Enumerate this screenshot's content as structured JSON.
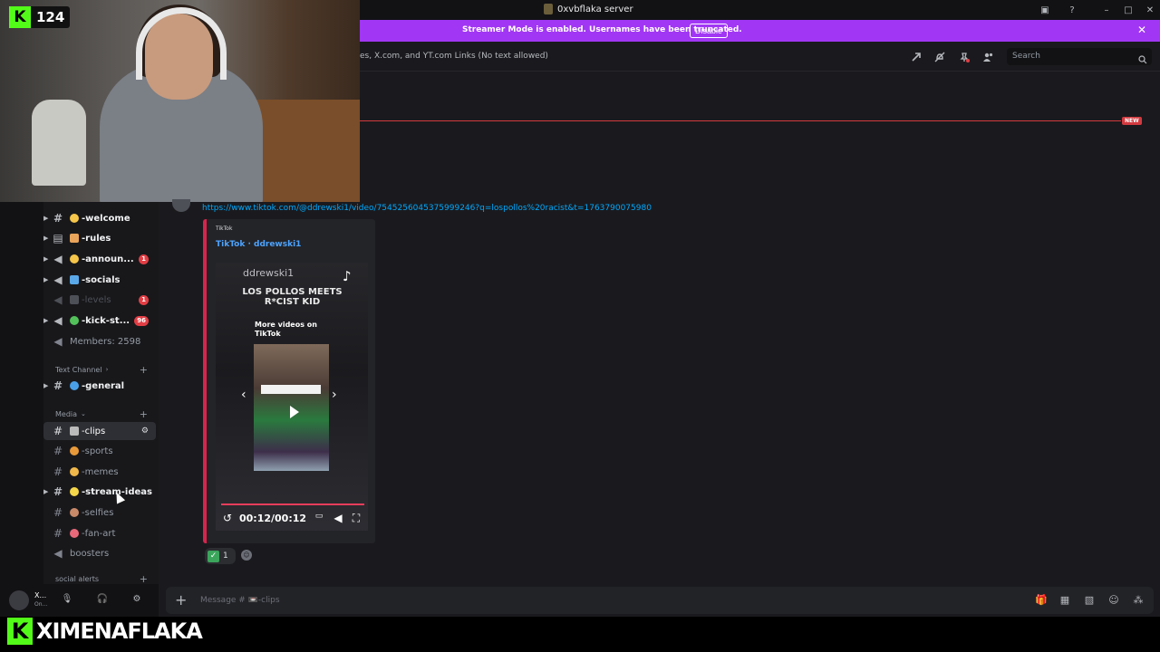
{
  "window": {
    "title": "0xvbflaka server"
  },
  "banner": {
    "text": "Streamer Mode is enabled. Usernames have been truncated.",
    "button": "Disable"
  },
  "header": {
    "topic": "es, X.com, and YT.com Links (No text allowed)",
    "search_placeholder": "Search"
  },
  "divider": {
    "new_label": "NEW"
  },
  "overlay": {
    "viewer_count": "124",
    "brand_name": "XIMENAFLAKA"
  },
  "sidebar": {
    "channels": [
      {
        "name": "-welcome",
        "badge": ""
      },
      {
        "name": "-rules",
        "badge": ""
      },
      {
        "name": "-announ...",
        "badge": "1"
      },
      {
        "name": "-socials",
        "badge": ""
      },
      {
        "name": "-levels",
        "badge": "1"
      },
      {
        "name": "-kick-st...",
        "badge": "96"
      },
      {
        "name": "Members: 2598",
        "badge": ""
      }
    ],
    "categories": {
      "text": "Text Channel",
      "media": "Media",
      "social": "social alerts"
    },
    "general": "-general",
    "media_channels": [
      "-clips",
      "-sports",
      "-memes",
      "-stream-ideas",
      "-selfies",
      "-fan-art",
      "boosters"
    ]
  },
  "user": {
    "name": "X...",
    "status": "On..."
  },
  "message": {
    "link": "https://www.tiktok.com/@ddrewski1/video/7545256045375999246?q=lospollos%20racist&t=1763790075980",
    "embed_provider": "TikTok",
    "embed_author": "TikTok · ddrewski1",
    "video_handle": "ddrewski1",
    "video_title": "LOS POLLOS MEETS R*CIST KID",
    "more_videos": "More videos on TikTok",
    "time": "00:12/00:12",
    "progress": 1.0,
    "reaction_count": "1"
  },
  "composer": {
    "placeholder": "Message # 📼-clips"
  }
}
